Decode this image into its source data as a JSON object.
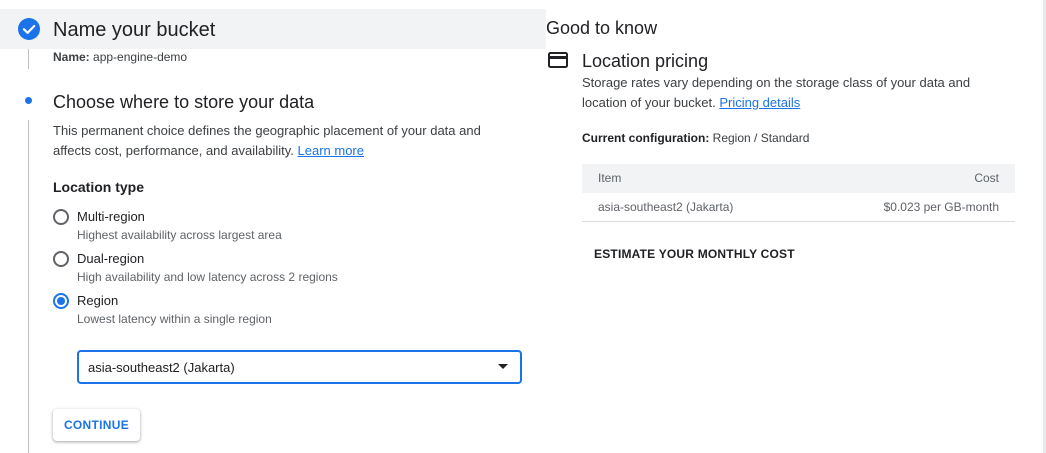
{
  "colors": {
    "accent": "#1a73e8",
    "step_bar_bg": "#f1f3f4",
    "text_primary": "#202124",
    "text_secondary": "#5f6368"
  },
  "step1": {
    "icon": "check-circle-icon",
    "title": "Name your bucket",
    "name_key": "Name:",
    "name_value": "app-engine-demo"
  },
  "step2": {
    "icon": "active-step-dot-icon",
    "title": "Choose where to store your data",
    "description": "This permanent choice defines the geographic placement of your data and affects cost, performance, and availability.",
    "learn_more": "Learn more",
    "location_type_label": "Location type",
    "options": [
      {
        "label": "Multi-region",
        "hint": "Highest availability across largest area",
        "selected": false
      },
      {
        "label": "Dual-region",
        "hint": "High availability and low latency across 2 regions",
        "selected": false
      },
      {
        "label": "Region",
        "hint": "Lowest latency within a single region",
        "selected": true
      }
    ],
    "region_select": {
      "value": "asia-southeast2 (Jakarta)"
    },
    "continue_label": "CONTINUE"
  },
  "good_to_know": {
    "title": "Good to know",
    "pricing": {
      "icon": "credit-card-icon",
      "title": "Location pricing",
      "description": "Storage rates vary depending on the storage class of your data and location of your bucket.",
      "pricing_link": "Pricing details",
      "current_config_key": "Current configuration:",
      "current_config_value": "Region / Standard",
      "table": {
        "headers": [
          "Item",
          "Cost"
        ],
        "rows": [
          [
            "asia-southeast2 (Jakarta)",
            "$0.023 per GB-month"
          ]
        ]
      },
      "estimate_label": "ESTIMATE YOUR MONTHLY COST"
    }
  }
}
